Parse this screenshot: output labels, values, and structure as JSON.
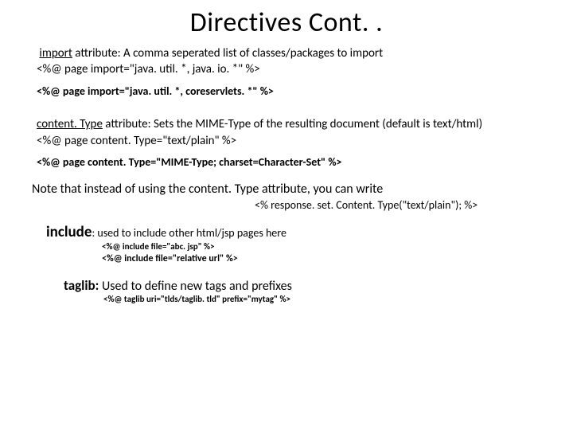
{
  "title": "Directives Cont. .",
  "import_attr": {
    "label": "import",
    "desc": " attribute: A comma seperated list of classes/packages to import",
    "code1": "<%@ page import=\"java. util. *, java. io. *\" %>",
    "code2": "<%@ page import=\"java. util. *, coreservlets. *\" %>"
  },
  "content_type": {
    "label": "content. Type",
    "desc": " attribute: Sets the MIME-Type of the resulting document (default is text/html)",
    "code1": "<%@ page content. Type=\"text/plain\" %>",
    "code2": "<%@ page content. Type=\"MIME-Type; charset=Character-Set\" %>"
  },
  "note_line": "Note that instead of using the content. Type attribute, you can write",
  "response_line": "<% response. set. Content. Type(\"text/plain\"); %>",
  "include": {
    "label": "include",
    "desc": ": used to include other html/jsp pages here",
    "code1": "<%@ include file=\"abc. jsp\" %>",
    "code2": "<%@ include file=\"relative url\" %>"
  },
  "taglib": {
    "label": "taglib:",
    "desc": " Used to define new tags and prefixes",
    "code1": "<%@ taglib uri=\"tlds/taglib. tld\" prefix=\"mytag\" %>"
  }
}
